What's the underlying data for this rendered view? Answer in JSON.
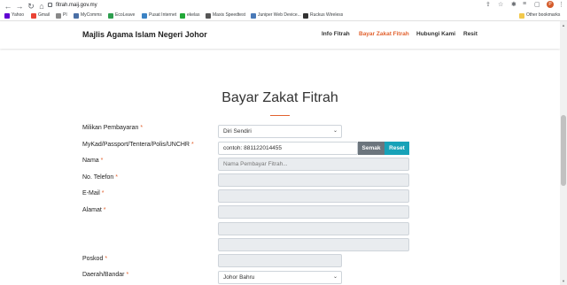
{
  "browser": {
    "url": "fitrah.maij.gov.my",
    "bookmarks": [
      {
        "label": "Yahoo",
        "color": "#6001d2"
      },
      {
        "label": "Gmail",
        "color": "#ea4335"
      },
      {
        "label": "PI",
        "color": "#888888"
      },
      {
        "label": "MyComms",
        "color": "#4a6fa5"
      },
      {
        "label": "EcoLeave",
        "color": "#2e9e4f"
      },
      {
        "label": "Pusat Internet",
        "color": "#3b82c4"
      },
      {
        "label": "ekelas",
        "color": "#22a838"
      },
      {
        "label": "Maxis Speedtest",
        "color": "#555555"
      },
      {
        "label": "Juniper Web Device...",
        "color": "#4a7ab8"
      },
      {
        "label": "Ruckus Wireless",
        "color": "#333333"
      },
      {
        "label": "Other bookmarks",
        "color": "#f2c94c"
      }
    ],
    "avatar_letter": "P"
  },
  "header": {
    "brand": "Majlis Agama Islam Negeri Johor",
    "menu": [
      "Info Fitrah",
      "Bayar Zakat Fitrah",
      "Hubungi Kami",
      "Resit"
    ],
    "accent": "#e2622f"
  },
  "main": {
    "title": "Bayar Zakat Fitrah",
    "form": {
      "milikan_label": "Milikan Pembayaran",
      "milikan_value": "Diri Sendiri",
      "mykad_label": "MyKad/Passport/Tentera/Polis/UNCHR",
      "mykad_placeholder": "contoh: 881122014455",
      "semak_label": "Semak",
      "reset_label": "Reset",
      "nama_label": "Nama",
      "nama_placeholder": "Nama Pembayar Fitrah...",
      "telefon_label": "No. Telefon",
      "email_label": "E-Mail",
      "alamat_label": "Alamat",
      "poskod_label": "Poskod",
      "daerah_label": "Daerah/Bandar",
      "daerah_value": "Johor Bahru",
      "required_mark": "*"
    }
  }
}
